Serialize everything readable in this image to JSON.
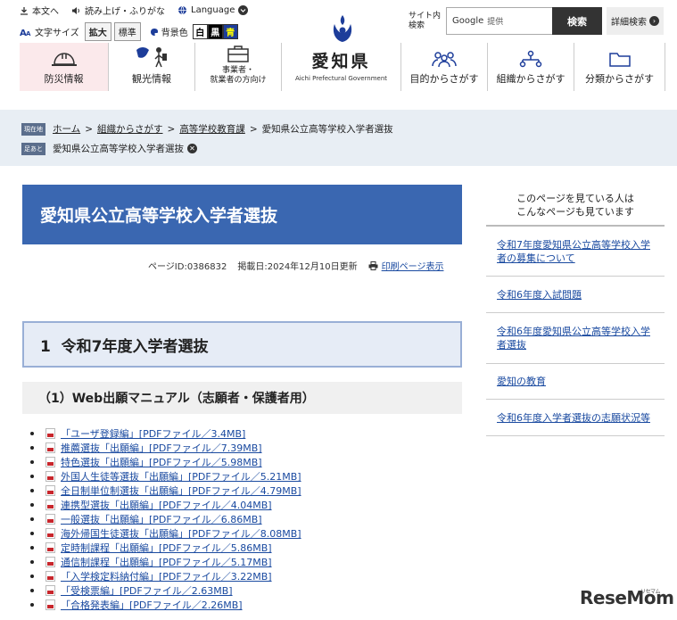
{
  "utility": {
    "skip_to_content": "本文へ",
    "read_aloud": "読み上げ・ふりがな",
    "language": "Language",
    "font_size_label": "文字サイズ",
    "font_enlarge": "拡大",
    "font_standard": "標準",
    "bg_color_label": "背景色",
    "bg_white": "白",
    "bg_black": "黒",
    "bg_blue": "青",
    "site_search_label": "サイト内\n検索",
    "search_provider": "Google",
    "search_provider_suffix": "提供",
    "search_button": "検索",
    "advanced_search": "詳細検索"
  },
  "brand": {
    "name": "愛知県",
    "name_en": "Aichi Prefectural Government"
  },
  "gnav": [
    {
      "label": "防災情報"
    },
    {
      "label": "観光情報"
    },
    {
      "label": "事業者・\n就業者の方向け"
    },
    {
      "label": "目的からさがす"
    },
    {
      "label": "組織からさがす"
    },
    {
      "label": "分類からさがす"
    }
  ],
  "breadcrumb": {
    "current_tag": "現在地",
    "items": [
      "ホーム",
      "組織からさがす",
      "高等学校教育課",
      "愛知県公立高等学校入学者選抜"
    ],
    "history_tag": "足あと",
    "history_item": "愛知県公立高等学校入学者選抜"
  },
  "main": {
    "title": "愛知県公立高等学校入学者選抜",
    "page_id": "ページID:0386832",
    "published": "掲載日:2024年12月10日更新",
    "print": "印刷ページ表示",
    "section_heading": "1  令和7年度入学者選抜",
    "subsection_heading": "（1）Web出願マニュアル（志願者・保護者用）",
    "pdf_links": [
      "「ユーザ登録編」[PDFファイル／3.4MB]",
      "推薦選抜「出願編」[PDFファイル／7.39MB]",
      "特色選抜「出願編」[PDFファイル／5.98MB]",
      "外国人生徒等選抜「出願編」[PDFファイル／5.21MB]",
      "全日制単位制選抜「出願編」[PDFファイル／4.79MB]",
      "連携型選抜「出願編」[PDFファイル／4.04MB]",
      "一般選抜「出願編」[PDFファイル／6.86MB]",
      "海外帰国生徒選抜「出願編」[PDFファイル／8.08MB]",
      "定時制課程「出願編」[PDFファイル／5.86MB]",
      "通信制課程「出願編」[PDFファイル／5.17MB]",
      "「入学検定料納付編」[PDFファイル／3.22MB]",
      "「受検票編」[PDFファイル／2.63MB]",
      "「合格発表編」[PDFファイル／2.26MB]"
    ]
  },
  "side": {
    "heading": "このページを見ている人は\nこんなページも見ています",
    "links": [
      "令和7年度愛知県公立高等学校入学者の募集について",
      "令和6年度入試問題",
      "令和6年度愛知県公立高等学校入学者選抜",
      "愛知の教育",
      "令和6年度入学者選抜の志願状況等"
    ]
  },
  "watermark": {
    "text": "ReseMom",
    "small": "リセマム"
  },
  "colors": {
    "title_bg": "#3a67b1",
    "link": "#1a4aa0",
    "breadcrumb_bg": "#e8eef4",
    "disaster_bg": "#fbe9eb"
  }
}
